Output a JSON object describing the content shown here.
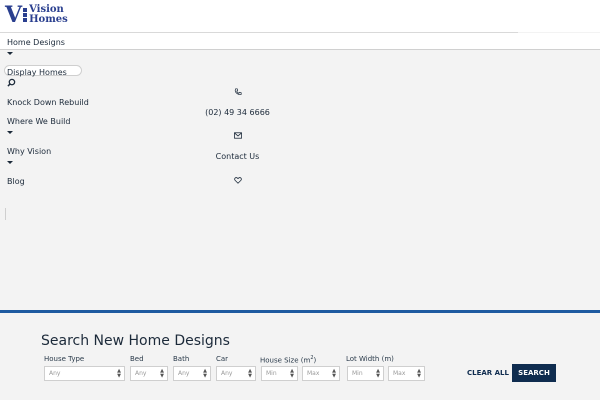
{
  "brand": {
    "logo_letter": "V",
    "logo_line1": "Vision",
    "logo_line2": "Homes"
  },
  "nav": {
    "items": [
      {
        "label": "Home Designs",
        "has_dropdown": true
      },
      {
        "label": "Display Homes",
        "has_dropdown": false
      },
      {
        "label": "Knock Down Rebuild",
        "has_dropdown": false
      },
      {
        "label": "Where We Build",
        "has_dropdown": true
      },
      {
        "label": "Why Vision",
        "has_dropdown": true
      },
      {
        "label": "Blog",
        "has_dropdown": false
      }
    ],
    "search_icon": "search-icon"
  },
  "contact": {
    "phone_icon": "phone-icon",
    "phone": "(02) 49 34 6666",
    "mail_icon": "envelope-icon",
    "contact_label": "Contact Us",
    "heart_icon": "heart-icon"
  },
  "search": {
    "title": "Search New Home Designs",
    "labels": {
      "house_type": "House Type",
      "bed": "Bed",
      "bath": "Bath",
      "car": "Car",
      "house_size": "House Size (m",
      "house_size_sup": "2",
      "house_size_close": ")",
      "lot_width": "Lot Width (m)"
    },
    "fields": {
      "house_type": "Any",
      "bed": "Any",
      "bath": "Any",
      "car": "Any",
      "size_min": "Min",
      "size_max": "Max",
      "lot_min": "Min",
      "lot_max": "Max"
    },
    "clear_label": "CLEAR ALL",
    "search_label": "SEARCH"
  },
  "colors": {
    "brand_blue": "#2a3f8f",
    "accent_blue": "#1e5aa0",
    "button_navy": "#0f2c4f",
    "background": "#f3f3f3"
  }
}
